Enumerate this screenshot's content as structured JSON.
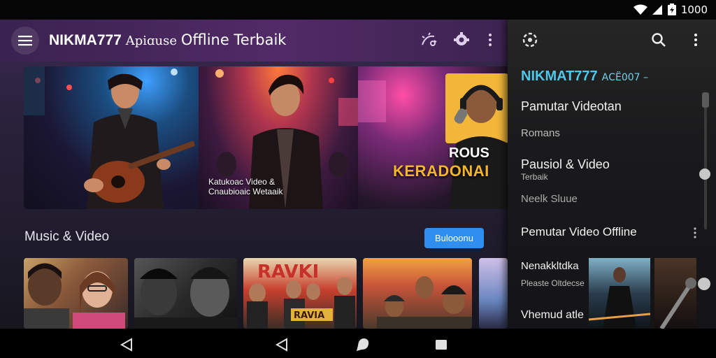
{
  "status_bar": {
    "time": "1000"
  },
  "app_bar": {
    "title_brand": "NIKMA777",
    "title_mid": "Apiɑuse",
    "title_end": "Offline Terbaik"
  },
  "hero": {
    "caption_line1": "Katukoac Video &",
    "caption_line2": "Cnaubioaic Wetaaik",
    "text_rous": "ROUS",
    "text_kerad": "KERADONAI"
  },
  "section": {
    "title": "Music & Video",
    "button_label": "Bulooonu"
  },
  "drawer": {
    "brand": "NIKMAT777",
    "brand_sub": "AⅭЁ007 –",
    "items": [
      {
        "label": "Pamutar Videotan"
      },
      {
        "label": "Romans"
      },
      {
        "label": "Pausiol & Video"
      },
      {
        "label": "Terbaik"
      },
      {
        "label": "Neelk Sluue"
      },
      {
        "label": "Pemutar Video Offline"
      },
      {
        "label": "Nenakkltdka"
      },
      {
        "label": "Pleaste Oltdecse"
      },
      {
        "label": "Vhemud atle"
      }
    ]
  }
}
